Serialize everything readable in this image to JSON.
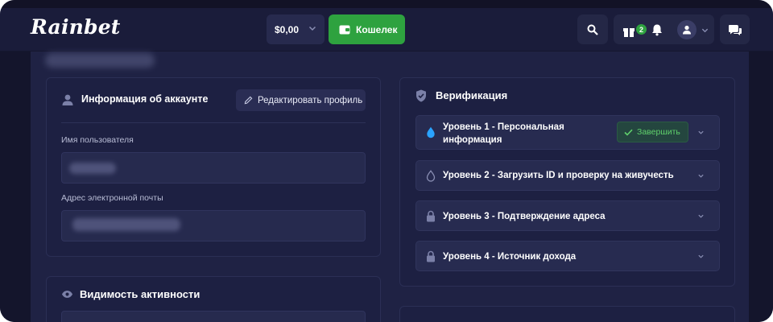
{
  "header": {
    "logo": "Rainbet",
    "balance": "$0,00",
    "wallet_label": "Кошелек",
    "gift_badge": "2"
  },
  "account_card": {
    "title": "Информация об аккаунте",
    "edit_button": "Редактировать профиль",
    "username_label": "Имя пользователя",
    "email_label": "Адрес электронной почты"
  },
  "activity_card": {
    "title": "Видимость активности"
  },
  "verification_card": {
    "title": "Верификация",
    "levels": [
      {
        "label_line1": "Уровень 1 - Персональная",
        "label_line2": "информация",
        "action": "Завершить",
        "icon": "droplet-filled-icon"
      },
      {
        "label": "Уровень 2 - Загрузить ID и проверку на живучесть",
        "icon": "droplet-outline-icon"
      },
      {
        "label": "Уровень 3 - Подтверждение адреса",
        "icon": "lock-icon"
      },
      {
        "label": "Уровень 4 - Источник дохода",
        "icon": "lock-icon"
      }
    ]
  },
  "colors": {
    "background": "#1b1d3c",
    "card": "#1d2042",
    "accent_green": "#2ea23f",
    "verified_blue": "#2aa3ff"
  }
}
